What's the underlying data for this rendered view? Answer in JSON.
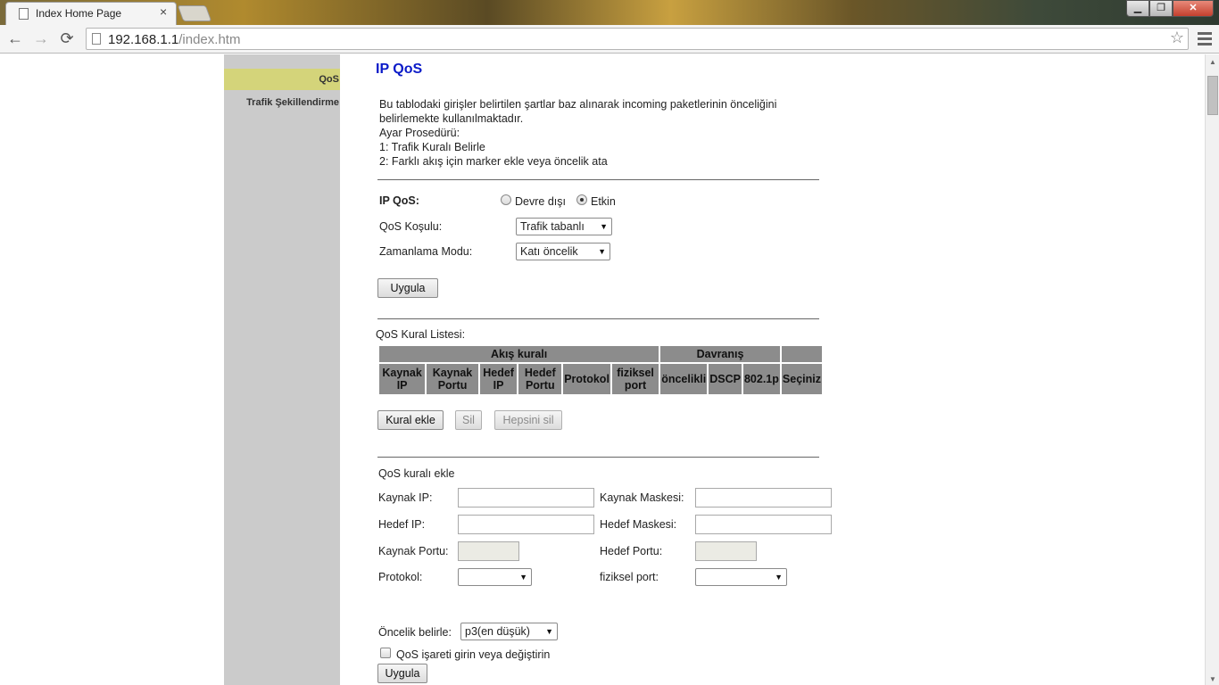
{
  "browser": {
    "tab_title": "Index Home Page",
    "tab_close": "×",
    "url_host": "192.168.1.1",
    "url_path": "/index.htm",
    "win_min": "▁",
    "win_max": "❐",
    "win_close": "✕",
    "back": "←",
    "forward": "→",
    "reload": "⟳",
    "star": "☆"
  },
  "sidebar": {
    "items": [
      {
        "label": "QoS",
        "active": true
      },
      {
        "label": "Trafik Şekillendirme",
        "active": false
      }
    ]
  },
  "page": {
    "title": "IP QoS",
    "description": [
      "Bu tablodaki girişler belirtilen şartlar baz alınarak incoming paketlerinin önceliğini",
      "belirlemekte kullanılmaktadır.",
      "Ayar Prosedürü:",
      "1: Trafik Kuralı Belirle",
      "2: Farklı akış için marker ekle veya öncelik ata"
    ]
  },
  "settings": {
    "ipqos_label": "IP QoS:",
    "disabled_label": "Devre dışı",
    "enabled_label": "Etkin",
    "selected": "Etkin",
    "condition_label": "QoS Koşulu:",
    "condition_value": "Trafik tabanlı",
    "schedule_label": "Zamanlama Modu:",
    "schedule_value": "Katı öncelik",
    "apply_label": "Uygula"
  },
  "rule_list": {
    "title": "QoS Kural Listesi:",
    "group_flow": "Akış kuralı",
    "group_behavior": "Davranış",
    "columns": [
      "Kaynak IP",
      "Kaynak Portu",
      "Hedef IP",
      "Hedef Portu",
      "Protokol",
      "fiziksel port",
      "öncelikli",
      "DSCP",
      "802.1p",
      "Seçiniz"
    ],
    "add_label": "Kural ekle",
    "delete_label": "Sil",
    "delete_all_label": "Hepsini sil"
  },
  "add_rule": {
    "title": "QoS kuralı ekle",
    "src_ip_label": "Kaynak IP:",
    "src_mask_label": "Kaynak Maskesi:",
    "dst_ip_label": "Hedef IP:",
    "dst_mask_label": "Hedef Maskesi:",
    "src_port_label": "Kaynak Portu:",
    "dst_port_label": "Hedef Portu:",
    "protocol_label": "Protokol:",
    "phys_port_label": "fiziksel port:",
    "priority_label": "Öncelik belirle:",
    "priority_value": "p3(en düşük)",
    "mark_label": "QoS işareti girin veya değiştirin",
    "apply_label": "Uygula"
  }
}
